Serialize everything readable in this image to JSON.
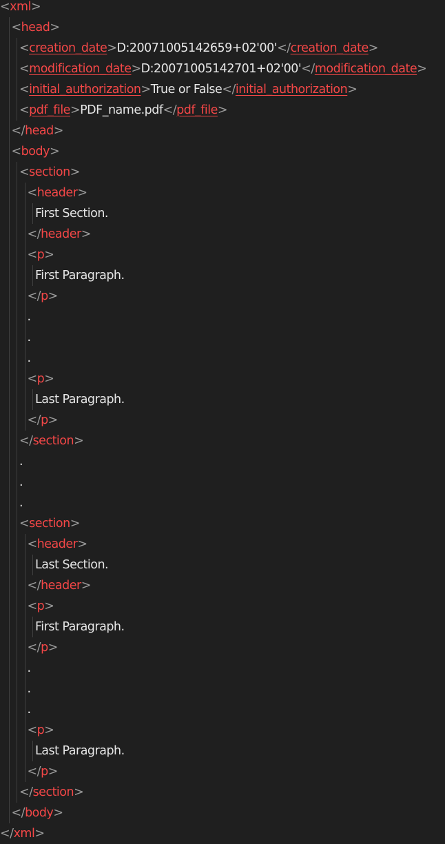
{
  "editor": {
    "language": "xml",
    "colors": {
      "background": "#1f1f1f",
      "tag": "#f44747",
      "punctuation": "#9a9a9a",
      "text": "#e6e6e6",
      "indent_guide": "#404040"
    },
    "lines": [
      {
        "indent": 0,
        "parts": [
          {
            "k": "p",
            "v": "<"
          },
          {
            "k": "t",
            "v": "xml"
          },
          {
            "k": "p",
            "v": ">"
          }
        ]
      },
      {
        "indent": 1,
        "parts": [
          {
            "k": "p",
            "v": "<"
          },
          {
            "k": "t",
            "v": "head"
          },
          {
            "k": "p",
            "v": ">"
          }
        ]
      },
      {
        "indent": 2,
        "parts": [
          {
            "k": "p",
            "v": "<"
          },
          {
            "k": "t",
            "v": "creation_date"
          },
          {
            "k": "p",
            "v": ">"
          },
          {
            "k": "x",
            "v": "D:20071005142659+02'00'"
          },
          {
            "k": "p",
            "v": "</"
          },
          {
            "k": "t",
            "v": "creation_date"
          },
          {
            "k": "p",
            "v": ">"
          }
        ]
      },
      {
        "indent": 2,
        "parts": [
          {
            "k": "p",
            "v": "<"
          },
          {
            "k": "t",
            "v": "modification_date"
          },
          {
            "k": "p",
            "v": ">"
          },
          {
            "k": "x",
            "v": "D:20071005142701+02'00'"
          },
          {
            "k": "p",
            "v": "</"
          },
          {
            "k": "t",
            "v": "modification_date"
          },
          {
            "k": "p",
            "v": ">"
          }
        ]
      },
      {
        "indent": 2,
        "parts": [
          {
            "k": "p",
            "v": "<"
          },
          {
            "k": "t",
            "v": "initial_authorization"
          },
          {
            "k": "p",
            "v": ">"
          },
          {
            "k": "x",
            "v": "True or False"
          },
          {
            "k": "p",
            "v": "</"
          },
          {
            "k": "t",
            "v": "initial_authorization"
          },
          {
            "k": "p",
            "v": ">"
          }
        ]
      },
      {
        "indent": 2,
        "parts": [
          {
            "k": "p",
            "v": "<"
          },
          {
            "k": "t",
            "v": "pdf_file"
          },
          {
            "k": "p",
            "v": ">"
          },
          {
            "k": "x",
            "v": "PDF_name.pdf"
          },
          {
            "k": "p",
            "v": "</"
          },
          {
            "k": "t",
            "v": "pdf_file"
          },
          {
            "k": "p",
            "v": ">"
          }
        ]
      },
      {
        "indent": 1,
        "parts": [
          {
            "k": "p",
            "v": "</"
          },
          {
            "k": "t",
            "v": "head"
          },
          {
            "k": "p",
            "v": ">"
          }
        ]
      },
      {
        "indent": 1,
        "parts": [
          {
            "k": "p",
            "v": "<"
          },
          {
            "k": "t",
            "v": "body"
          },
          {
            "k": "p",
            "v": ">"
          }
        ]
      },
      {
        "indent": 2,
        "parts": [
          {
            "k": "p",
            "v": "<"
          },
          {
            "k": "t",
            "v": "section"
          },
          {
            "k": "p",
            "v": ">"
          }
        ]
      },
      {
        "indent": 3,
        "parts": [
          {
            "k": "p",
            "v": "<"
          },
          {
            "k": "t",
            "v": "header"
          },
          {
            "k": "p",
            "v": ">"
          }
        ]
      },
      {
        "indent": 4,
        "parts": [
          {
            "k": "x",
            "v": "First Section."
          }
        ]
      },
      {
        "indent": 3,
        "parts": [
          {
            "k": "p",
            "v": "</"
          },
          {
            "k": "t",
            "v": "header"
          },
          {
            "k": "p",
            "v": ">"
          }
        ]
      },
      {
        "indent": 3,
        "parts": [
          {
            "k": "p",
            "v": "<"
          },
          {
            "k": "t",
            "v": "p"
          },
          {
            "k": "p",
            "v": ">"
          }
        ]
      },
      {
        "indent": 4,
        "parts": [
          {
            "k": "x",
            "v": "First Paragraph."
          }
        ]
      },
      {
        "indent": 3,
        "parts": [
          {
            "k": "p",
            "v": "</"
          },
          {
            "k": "t",
            "v": "p"
          },
          {
            "k": "p",
            "v": ">"
          }
        ]
      },
      {
        "indent": 3,
        "parts": [
          {
            "k": "x",
            "v": "."
          }
        ]
      },
      {
        "indent": 3,
        "parts": [
          {
            "k": "x",
            "v": "."
          }
        ]
      },
      {
        "indent": 3,
        "parts": [
          {
            "k": "x",
            "v": "."
          }
        ]
      },
      {
        "indent": 3,
        "parts": [
          {
            "k": "p",
            "v": "<"
          },
          {
            "k": "t",
            "v": "p"
          },
          {
            "k": "p",
            "v": ">"
          }
        ]
      },
      {
        "indent": 4,
        "parts": [
          {
            "k": "x",
            "v": "Last Paragraph."
          }
        ]
      },
      {
        "indent": 3,
        "parts": [
          {
            "k": "p",
            "v": "</"
          },
          {
            "k": "t",
            "v": "p"
          },
          {
            "k": "p",
            "v": ">"
          }
        ]
      },
      {
        "indent": 2,
        "parts": [
          {
            "k": "p",
            "v": "</"
          },
          {
            "k": "t",
            "v": "section"
          },
          {
            "k": "p",
            "v": ">"
          }
        ]
      },
      {
        "indent": 2,
        "parts": [
          {
            "k": "x",
            "v": "."
          }
        ]
      },
      {
        "indent": 2,
        "parts": [
          {
            "k": "x",
            "v": "."
          }
        ]
      },
      {
        "indent": 2,
        "parts": [
          {
            "k": "x",
            "v": "."
          }
        ]
      },
      {
        "indent": 2,
        "parts": [
          {
            "k": "p",
            "v": "<"
          },
          {
            "k": "t",
            "v": "section"
          },
          {
            "k": "p",
            "v": ">"
          }
        ]
      },
      {
        "indent": 3,
        "parts": [
          {
            "k": "p",
            "v": "<"
          },
          {
            "k": "t",
            "v": "header"
          },
          {
            "k": "p",
            "v": ">"
          }
        ]
      },
      {
        "indent": 4,
        "parts": [
          {
            "k": "x",
            "v": "Last Section."
          }
        ]
      },
      {
        "indent": 3,
        "parts": [
          {
            "k": "p",
            "v": "</"
          },
          {
            "k": "t",
            "v": "header"
          },
          {
            "k": "p",
            "v": ">"
          }
        ]
      },
      {
        "indent": 3,
        "parts": [
          {
            "k": "p",
            "v": "<"
          },
          {
            "k": "t",
            "v": "p"
          },
          {
            "k": "p",
            "v": ">"
          }
        ]
      },
      {
        "indent": 4,
        "parts": [
          {
            "k": "x",
            "v": "First Paragraph."
          }
        ]
      },
      {
        "indent": 3,
        "parts": [
          {
            "k": "p",
            "v": "</"
          },
          {
            "k": "t",
            "v": "p"
          },
          {
            "k": "p",
            "v": ">"
          }
        ]
      },
      {
        "indent": 3,
        "parts": [
          {
            "k": "x",
            "v": "."
          }
        ]
      },
      {
        "indent": 3,
        "parts": [
          {
            "k": "x",
            "v": "."
          }
        ]
      },
      {
        "indent": 3,
        "parts": [
          {
            "k": "x",
            "v": "."
          }
        ]
      },
      {
        "indent": 3,
        "parts": [
          {
            "k": "p",
            "v": "<"
          },
          {
            "k": "t",
            "v": "p"
          },
          {
            "k": "p",
            "v": ">"
          }
        ]
      },
      {
        "indent": 4,
        "parts": [
          {
            "k": "x",
            "v": "Last Paragraph."
          }
        ]
      },
      {
        "indent": 3,
        "parts": [
          {
            "k": "p",
            "v": "</"
          },
          {
            "k": "t",
            "v": "p"
          },
          {
            "k": "p",
            "v": ">"
          }
        ]
      },
      {
        "indent": 2,
        "parts": [
          {
            "k": "p",
            "v": "</"
          },
          {
            "k": "t",
            "v": "section"
          },
          {
            "k": "p",
            "v": ">"
          }
        ]
      },
      {
        "indent": 1,
        "parts": [
          {
            "k": "p",
            "v": "</"
          },
          {
            "k": "t",
            "v": "body"
          },
          {
            "k": "p",
            "v": ">"
          }
        ]
      },
      {
        "indent": 0,
        "parts": [
          {
            "k": "p",
            "v": "</"
          },
          {
            "k": "t",
            "v": "xml"
          },
          {
            "k": "p",
            "v": ">"
          }
        ]
      }
    ]
  }
}
